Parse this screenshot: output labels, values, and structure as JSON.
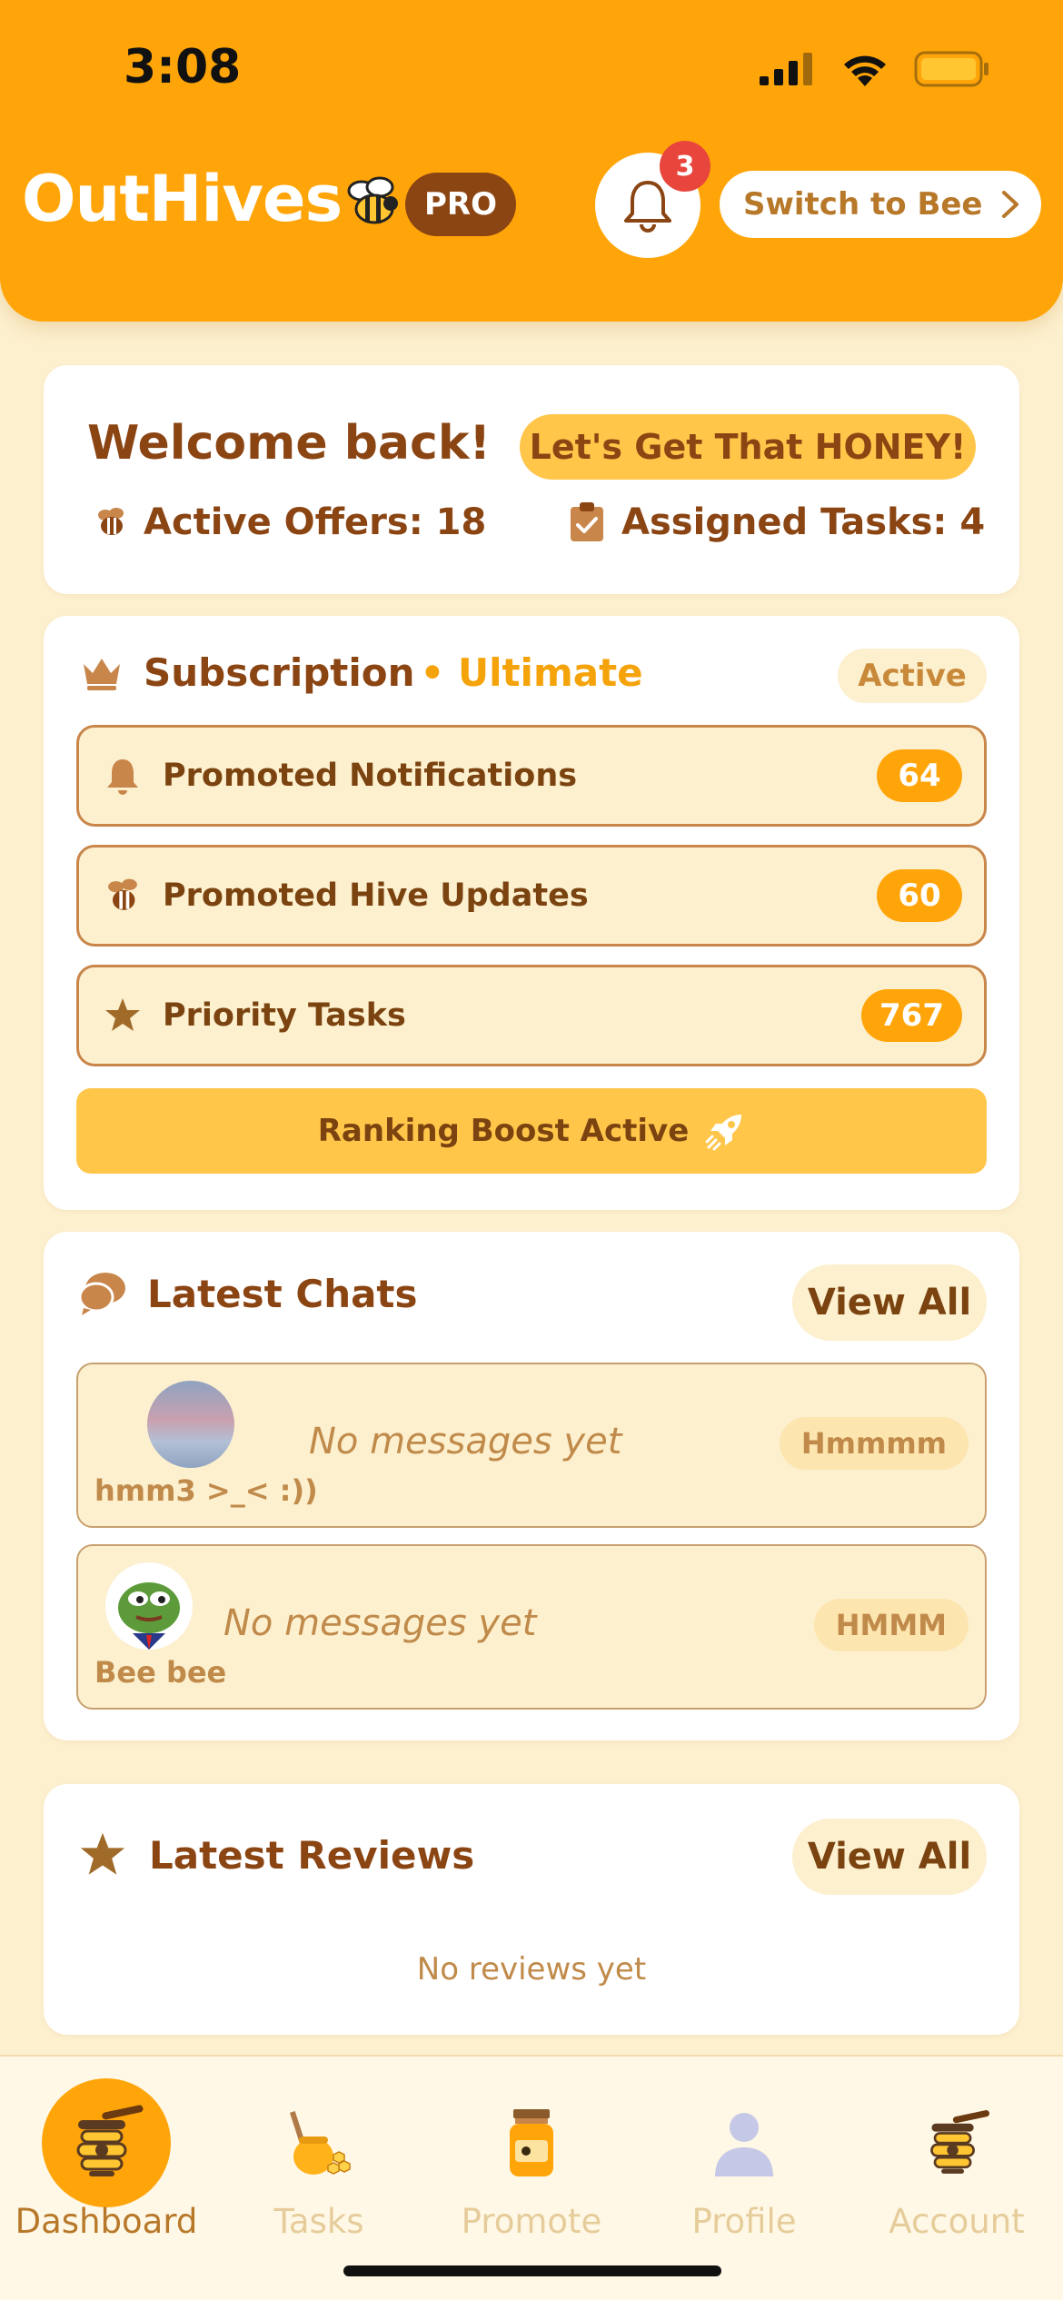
{
  "status_bar": {
    "time": "3:08"
  },
  "header": {
    "app_title": "OutHives",
    "pro_badge": "PRO",
    "notification_count": "3",
    "switch_label": "Switch to Bee"
  },
  "welcome": {
    "title": "Welcome back!",
    "tagline": "Let's Get That HONEY!",
    "active_offers": "Active Offers: 18",
    "assigned_tasks": "Assigned Tasks: 4"
  },
  "subscription": {
    "title": "Subscription",
    "plan": "• Ultimate",
    "status": "Active",
    "features": [
      {
        "label": "Promoted Notifications",
        "count": "64",
        "icon": "bell-icon"
      },
      {
        "label": "Promoted Hive Updates",
        "count": "60",
        "icon": "bee-icon"
      },
      {
        "label": "Priority Tasks",
        "count": "767",
        "icon": "star-icon"
      }
    ],
    "boost_label": "Ranking Boost Active"
  },
  "chats": {
    "title": "Latest Chats",
    "view_all": "View All",
    "items": [
      {
        "name": "hmm3 >_< :))",
        "message": "No messages yet",
        "tag": "Hmmmm"
      },
      {
        "name": "Bee bee",
        "message": "No messages yet",
        "tag": "HMMM"
      }
    ]
  },
  "reviews": {
    "title": "Latest Reviews",
    "view_all": "View All",
    "empty": "No reviews yet"
  },
  "nav": {
    "items": [
      {
        "label": "Dashboard",
        "icon": "honey-dipper-icon",
        "active": true
      },
      {
        "label": "Tasks",
        "icon": "honey-pot-icon",
        "active": false
      },
      {
        "label": "Promote",
        "icon": "honey-jar-icon",
        "active": false
      },
      {
        "label": "Profile",
        "icon": "person-icon",
        "active": false
      },
      {
        "label": "Account",
        "icon": "honey-dipper-icon",
        "active": false
      }
    ]
  },
  "colors": {
    "primary": "#ffa509",
    "brown": "#8b4513",
    "cream": "#fdf0cf",
    "badge_red": "#e8453c"
  }
}
